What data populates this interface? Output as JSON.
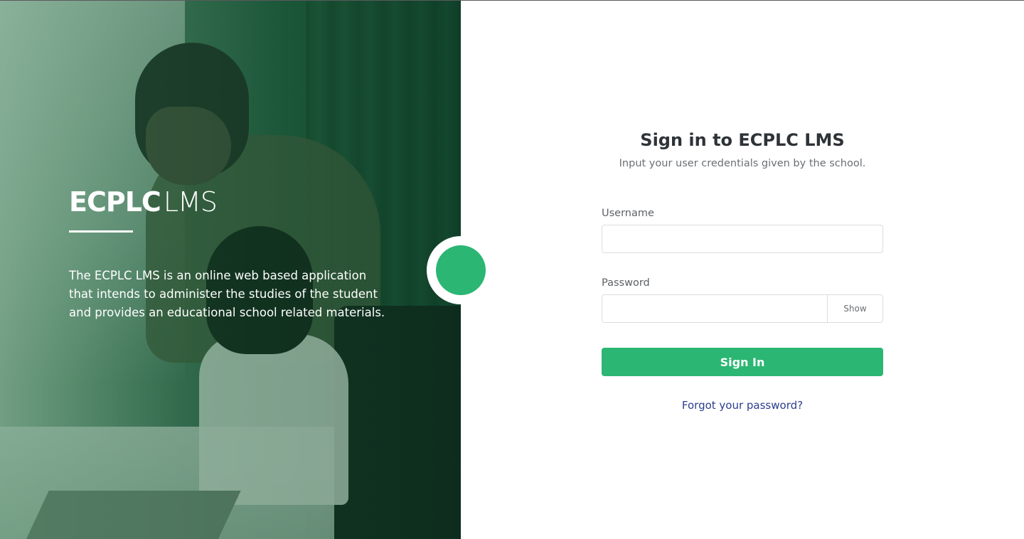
{
  "brand": {
    "name_bold": "ECPLC",
    "name_light": "LMS"
  },
  "hero": {
    "description": "The ECPLC LMS is an online web based application that intends to administer the studies of the student and provides an educational school related materials."
  },
  "form": {
    "title": "Sign in to ECPLC LMS",
    "subtitle": "Input your user credentials given by the school.",
    "username_label": "Username",
    "username_value": "",
    "password_label": "Password",
    "password_value": "",
    "show_label": "Show",
    "submit_label": "Sign In",
    "forgot_label": "Forgot your password?"
  },
  "colors": {
    "accent": "#2bb673",
    "link": "#2b3d8f",
    "hero_overlay": "#1f5a3c"
  }
}
